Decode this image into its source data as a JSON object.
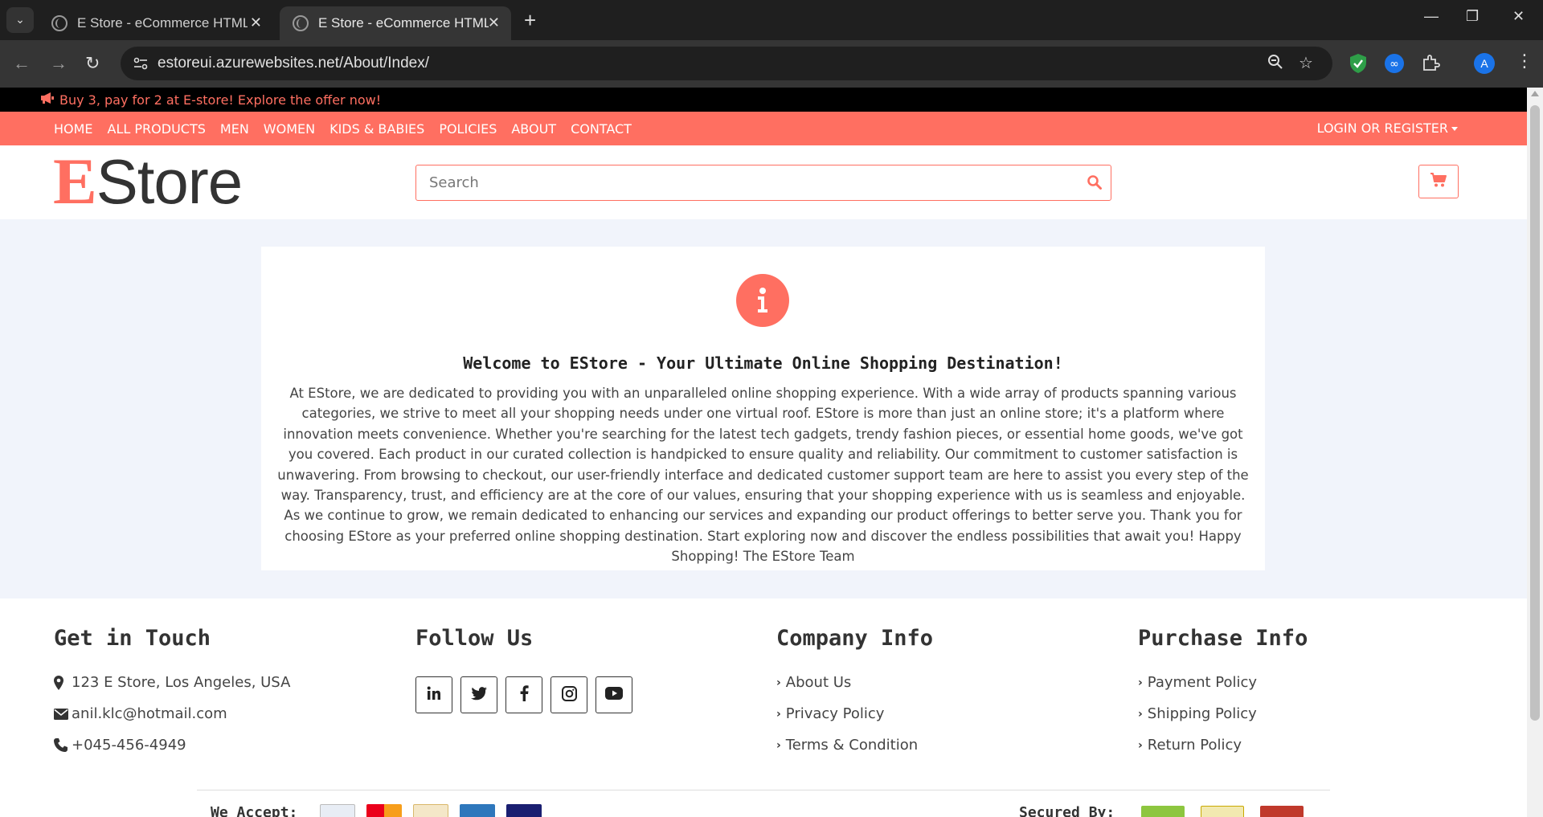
{
  "browser": {
    "tabs": [
      {
        "title": "E Store - eCommerce HTML Template",
        "active": false
      },
      {
        "title": "E Store - eCommerce HTML Template",
        "active": true
      }
    ],
    "url_domain": "estoreui.azurewebsites.net",
    "url_path": "/About/Index/",
    "profile_initial": "A"
  },
  "promo": {
    "text": "Buy 3, pay for 2 at E-store! Explore the offer now!"
  },
  "nav": {
    "items": [
      "HOME",
      "ALL PRODUCTS",
      "MEN",
      "WOMEN",
      "KIDS & BABIES",
      "POLICIES",
      "ABOUT",
      "CONTACT"
    ],
    "login": "LOGIN OR REGISTER"
  },
  "header": {
    "logo_first": "E",
    "logo_rest": "Store",
    "search_placeholder": "Search"
  },
  "about": {
    "heading": "Welcome to EStore - Your Ultimate Online Shopping Destination!",
    "body": "At EStore, we are dedicated to providing you with an unparalleled online shopping experience. With a wide array of products spanning various categories, we strive to meet all your shopping needs under one virtual roof. EStore is more than just an online store; it's a platform where innovation meets convenience. Whether you're searching for the latest tech gadgets, trendy fashion pieces, or essential home goods, we've got you covered. Each product in our curated collection is handpicked to ensure quality and reliability. Our commitment to customer satisfaction is unwavering. From browsing to checkout, our user-friendly interface and dedicated customer support team are here to assist you every step of the way. Transparency, trust, and efficiency are at the core of our values, ensuring that your shopping experience with us is seamless and enjoyable. As we continue to grow, we remain dedicated to enhancing our services and expanding our product offerings to better serve you. Thank you for choosing EStore as your preferred online shopping destination. Start exploring now and discover the endless possibilities that await you! Happy Shopping! The EStore Team"
  },
  "footer": {
    "touch": {
      "title": "Get in Touch",
      "address": "123 E Store, Los Angeles, USA",
      "email": "anil.klc@hotmail.com",
      "phone": "+045-456-4949"
    },
    "follow": {
      "title": "Follow Us",
      "icons": [
        "linkedin-icon",
        "twitter-icon",
        "facebook-icon",
        "instagram-icon",
        "youtube-icon"
      ]
    },
    "company": {
      "title": "Company Info",
      "links": [
        "About Us",
        "Privacy Policy",
        "Terms & Condition"
      ]
    },
    "purchase": {
      "title": "Purchase Info",
      "links": [
        "Payment Policy",
        "Shipping Policy",
        "Return Policy"
      ]
    },
    "accept_label": "We Accept:",
    "secured_label": "Secured By:"
  },
  "colors": {
    "accent": "#ff6f61",
    "content_bg": "#f1f4fb",
    "chrome_dark": "#1f1f1f"
  }
}
